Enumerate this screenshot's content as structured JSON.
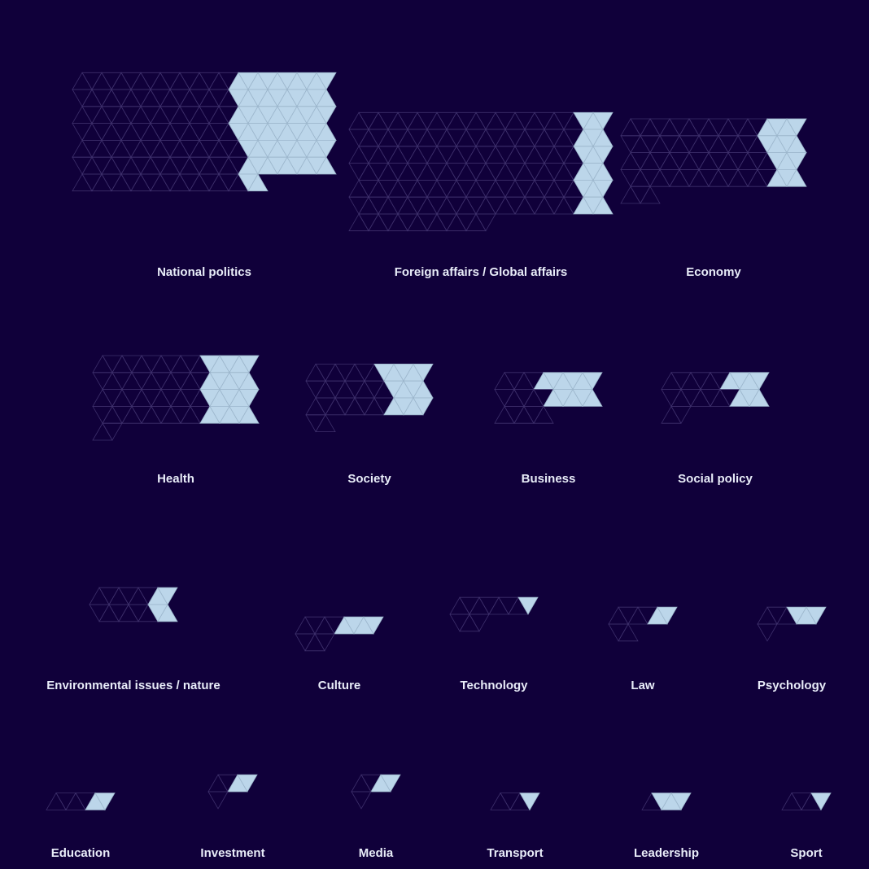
{
  "chart_data": {
    "type": "triangle-grid",
    "colors": {
      "background": "#10003a",
      "empty_stroke": "#3d2f6b",
      "filled": "#bcd6ea",
      "filled_stroke": "#9cb6cc",
      "label": "#e8ecf8"
    },
    "topics": [
      {
        "name": "National politics",
        "total": 175,
        "highlighted": 60
      },
      {
        "name": "Foreign affairs / Global affairs",
        "total": 170,
        "highlighted": 18
      },
      {
        "name": "Economy",
        "total": 75,
        "highlighted": 14
      },
      {
        "name": "Health",
        "total": 66,
        "highlighted": 20
      },
      {
        "name": "Society",
        "total": 38,
        "highlighted": 13
      },
      {
        "name": "Business",
        "total": 25,
        "highlighted": 11
      },
      {
        "name": "Social policy",
        "total": 22,
        "highlighted": 7
      },
      {
        "name": "Environmental issues / nature",
        "total": 16,
        "highlighted": 4
      },
      {
        "name": "Culture",
        "total": 11,
        "highlighted": 4
      },
      {
        "name": "Technology",
        "total": 11,
        "highlighted": 1
      },
      {
        "name": "Law",
        "total": 8,
        "highlighted": 2
      },
      {
        "name": "Psychology",
        "total": 7,
        "highlighted": 3
      },
      {
        "name": "Education",
        "total": 6,
        "highlighted": 2
      },
      {
        "name": "Investment",
        "total": 5,
        "highlighted": 2
      },
      {
        "name": "Media",
        "total": 5,
        "highlighted": 2
      },
      {
        "name": "Transport",
        "total": 4,
        "highlighted": 1
      },
      {
        "name": "Leadership",
        "total": 4,
        "highlighted": 3
      },
      {
        "name": "Sport",
        "total": 4,
        "highlighted": 1
      }
    ]
  }
}
